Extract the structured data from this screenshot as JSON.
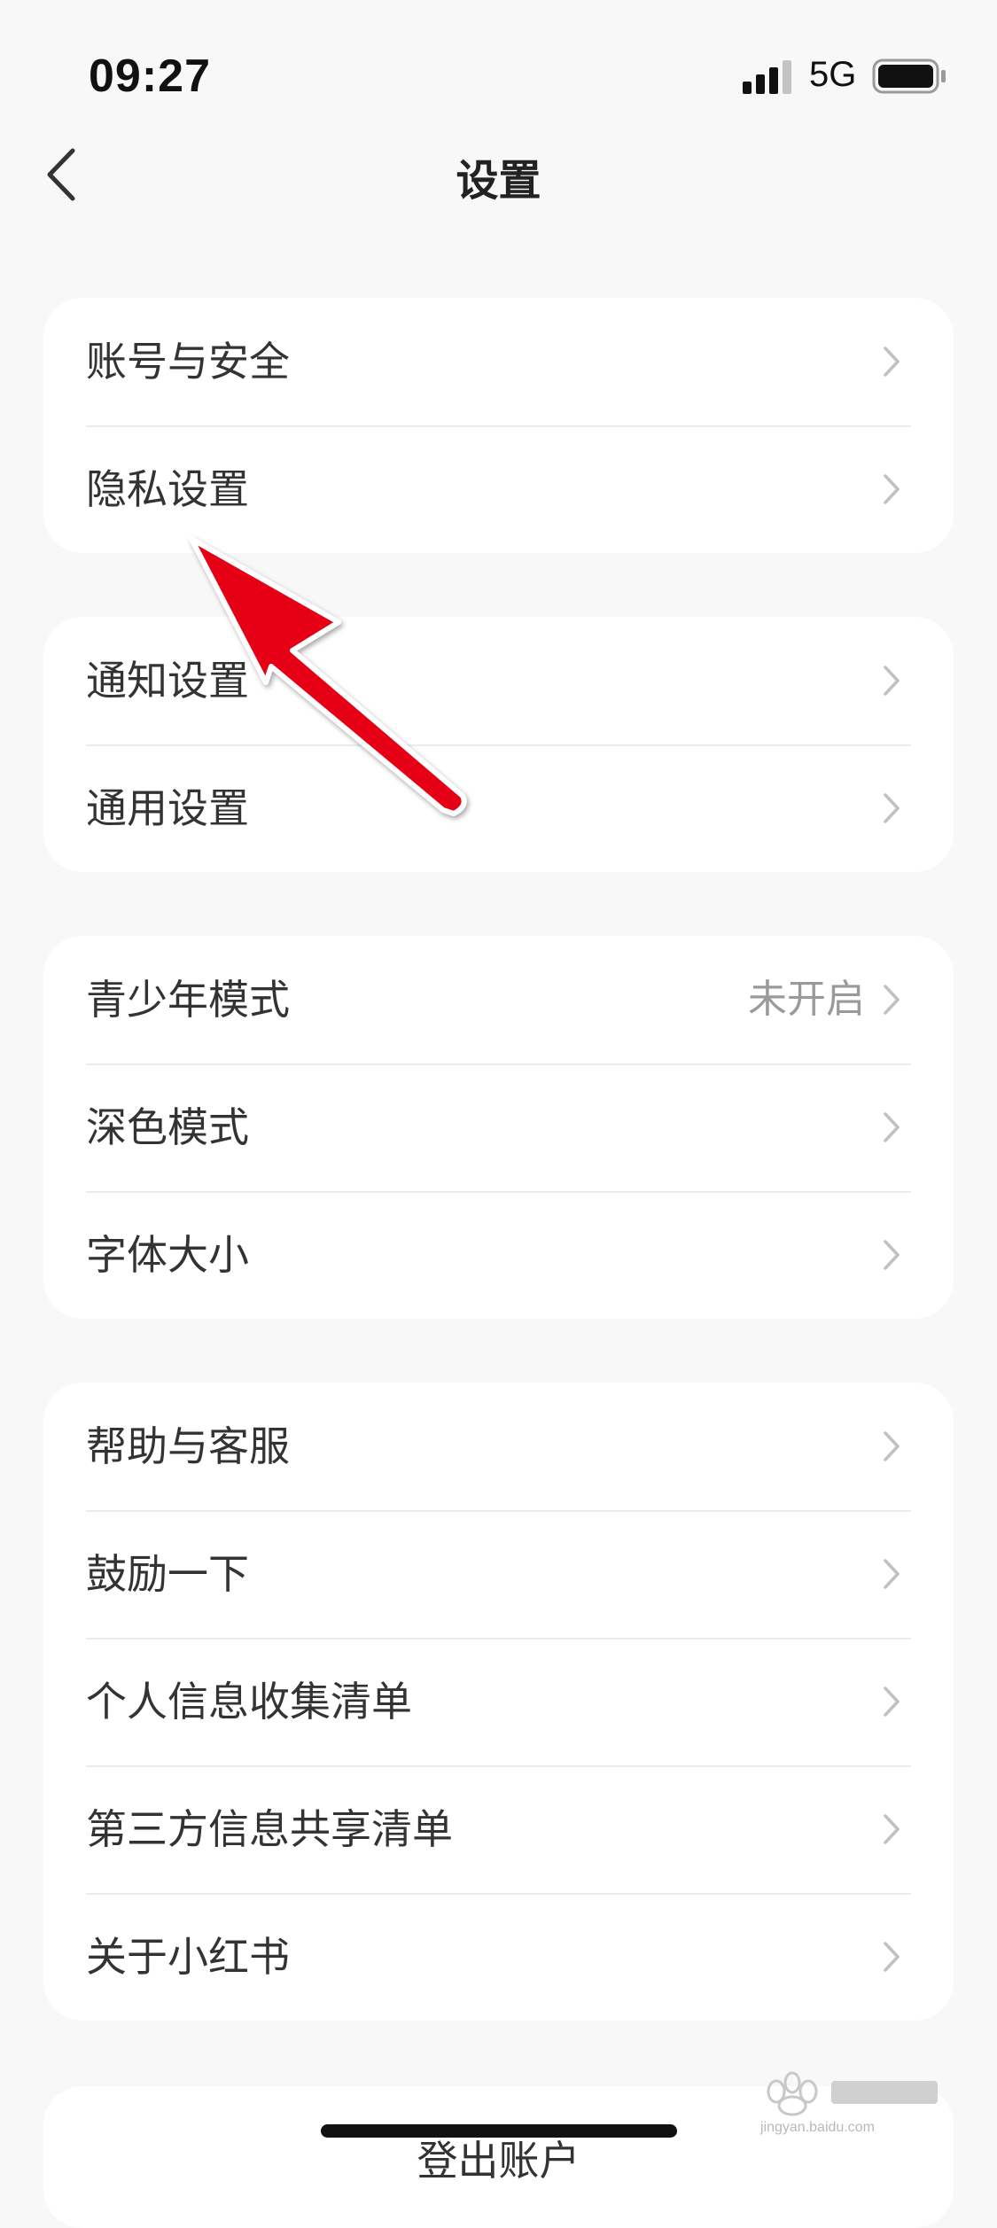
{
  "status_bar": {
    "time": "09:27",
    "network": "5G"
  },
  "header": {
    "title": "设置"
  },
  "groups": [
    {
      "items": [
        {
          "label": "账号与安全"
        },
        {
          "label": "隐私设置"
        }
      ]
    },
    {
      "items": [
        {
          "label": "通知设置"
        },
        {
          "label": "通用设置"
        }
      ]
    },
    {
      "items": [
        {
          "label": "青少年模式",
          "value": "未开启"
        },
        {
          "label": "深色模式"
        },
        {
          "label": "字体大小"
        }
      ]
    },
    {
      "items": [
        {
          "label": "帮助与客服"
        },
        {
          "label": "鼓励一下"
        },
        {
          "label": "个人信息收集清单"
        },
        {
          "label": "第三方信息共享清单"
        },
        {
          "label": "关于小红书"
        }
      ]
    }
  ],
  "logout": {
    "label": "登出账户"
  },
  "watermark": {
    "text": "jingyan.baidu.com"
  },
  "colors": {
    "background": "#f8f8f8",
    "card": "#ffffff",
    "annotation_arrow": "#e60012"
  }
}
